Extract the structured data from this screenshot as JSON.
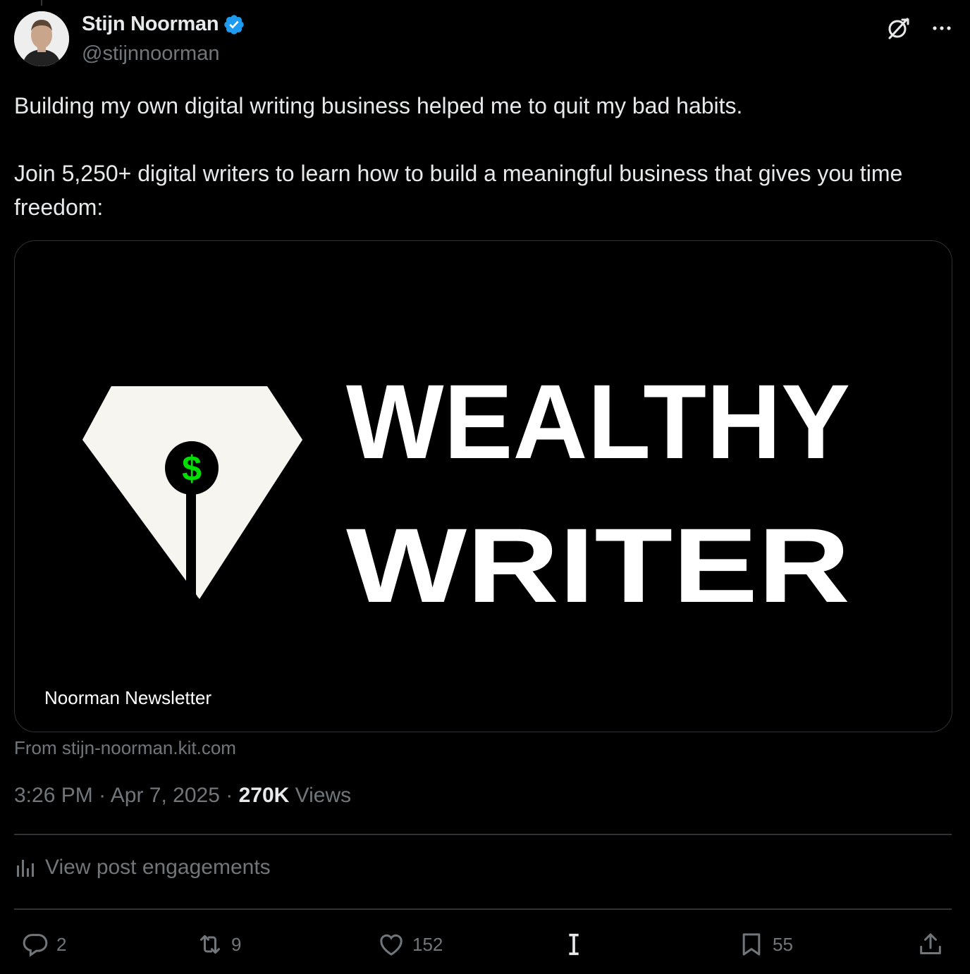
{
  "author": {
    "display_name": "Stijn Noorman",
    "handle": "@stijnnoorman",
    "verified": true
  },
  "header_icons": [
    "grok-icon",
    "more-icon"
  ],
  "tweet": {
    "text": "Building my own digital writing business helped me to quit my bad habits.\n\nJoin 5,250+ digital writers to learn how to build a meaningful business that gives you time freedom:"
  },
  "card": {
    "brand_line_1": "WEALTHY",
    "brand_line_2": "WRITER",
    "dollar_sign": "$",
    "title": "Noorman Newsletter",
    "source": "From stijn-noorman.kit.com"
  },
  "meta": {
    "time": "3:26 PM",
    "date": "Apr 7, 2025",
    "separator": "·",
    "views_count": "270K",
    "views_label": "Views"
  },
  "engagements_label": "View post engagements",
  "actions": {
    "replies": "2",
    "reposts": "9",
    "likes": "152",
    "bookmarks": "55"
  },
  "colors": {
    "background": "#000000",
    "text": "#e7e9ea",
    "muted": "#71767b",
    "verified": "#1d9bf0",
    "dollar_green": "#00e000",
    "border": "#2f3336"
  }
}
